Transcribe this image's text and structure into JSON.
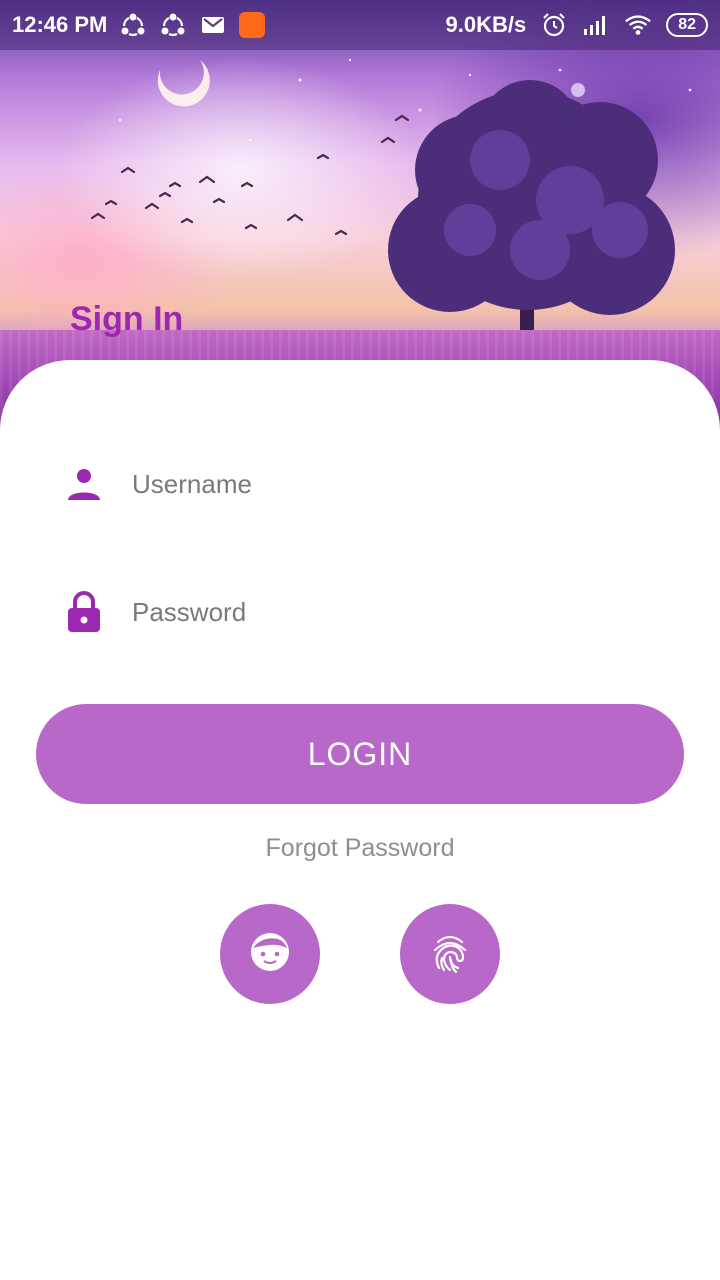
{
  "status_bar": {
    "time": "12:46 PM",
    "network_speed": "9.0KB/s",
    "battery": "82"
  },
  "header": {
    "title": "Sign In"
  },
  "form": {
    "username_placeholder": "Username",
    "password_placeholder": "Password",
    "login_label": "LOGIN",
    "forgot_label": "Forgot Password"
  },
  "biometric": {
    "face_icon": "face-icon",
    "fingerprint_icon": "fingerprint-icon"
  },
  "colors": {
    "accent": "#9c27b0",
    "button": "#b868c8",
    "hint_text": "#8e8e8e"
  }
}
